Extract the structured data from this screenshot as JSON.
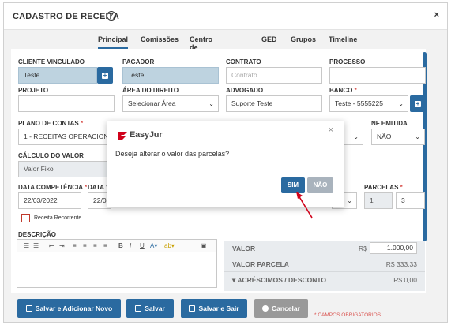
{
  "header": {
    "title": "CADASTRO DE RECEITA",
    "help": "?",
    "close": "×"
  },
  "tabs": [
    {
      "label": "Principal"
    },
    {
      "label": "Comissões"
    },
    {
      "label": "Centro de Receita"
    },
    {
      "label": "GED"
    },
    {
      "label": "Grupos"
    },
    {
      "label": "Timeline"
    }
  ],
  "form": {
    "cliente": {
      "label": "CLIENTE VINCULADO",
      "value": "Teste"
    },
    "pagador": {
      "label": "PAGADOR",
      "value": "Teste"
    },
    "contrato": {
      "label": "CONTRATO",
      "placeholder": "Contrato"
    },
    "processo": {
      "label": "PROCESSO",
      "value": ""
    },
    "projeto": {
      "label": "PROJETO",
      "value": ""
    },
    "area": {
      "label": "ÁREA DO DIREITO",
      "value": "Selecionar Área"
    },
    "advogado": {
      "label": "ADVOGADO",
      "value": "Suporte Teste"
    },
    "banco": {
      "label": "BANCO",
      "required": "*",
      "value": "Teste - 5555225"
    },
    "plano": {
      "label": "PLANO DE CONTAS",
      "required": "*",
      "value": "1 - RECEITAS OPERACIONA"
    },
    "nf": {
      "label": "NF EMITIDA",
      "value": "NÃO"
    },
    "calculo": {
      "label": "CÁLCULO DO VALOR",
      "value": "Valor Fixo"
    },
    "data_competencia": {
      "label": "DATA COMPETÊNCIA",
      "required": "*",
      "value": "22/03/2022"
    },
    "data_v": {
      "label": "DATA V",
      "value": "22/03"
    },
    "parcelas": {
      "label": "PARCELAS",
      "required": "*",
      "current": "1",
      "total": "3"
    },
    "recorrente": {
      "label": "Receita Recorrente"
    },
    "descricao": {
      "label": "DESCRIÇÃO"
    }
  },
  "values": {
    "valor": {
      "label": "VALOR",
      "currency": "R$",
      "value": "1.000,00"
    },
    "valor_parcela": {
      "label": "VALOR PARCELA",
      "value": "R$ 333,33"
    },
    "acrescimos": {
      "label": "▾ ACRÉSCIMOS / DESCONTO",
      "value": "R$ 0,00"
    }
  },
  "buttons": {
    "save_new": "Salvar e Adicionar Novo",
    "save": "Salvar",
    "save_exit": "Salvar e Sair",
    "cancel": "Cancelar"
  },
  "required_note": "* CAMPOS OBRIGATÓRIOS",
  "modal": {
    "brand": "EasyJur",
    "close": "×",
    "message": "Deseja alterar o valor das parcelas?",
    "yes": "SIM",
    "no": "NÃO"
  },
  "colors": {
    "primary": "#2a6aa0",
    "required": "#d9534f",
    "arrow": "#d0021b"
  }
}
